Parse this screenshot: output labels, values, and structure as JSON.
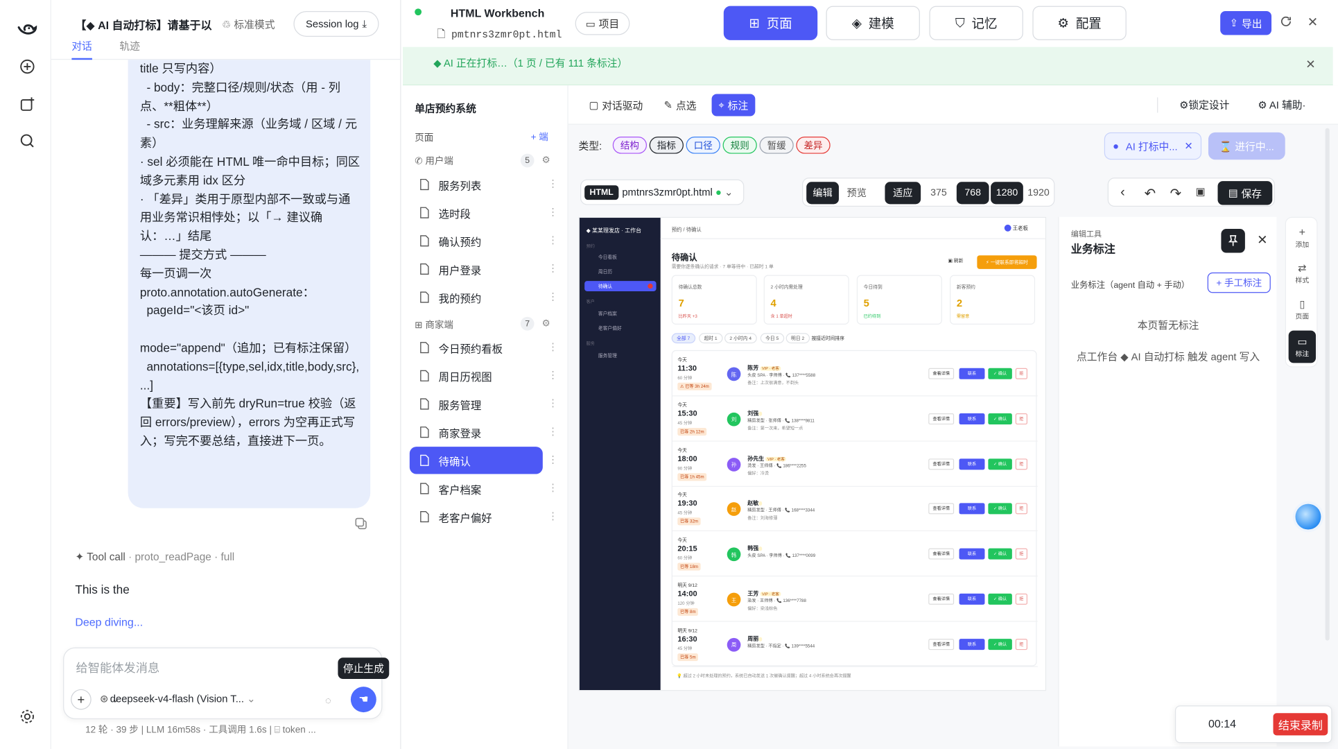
{
  "chat": {
    "title": "【◆ AI 自动打标】请基于以",
    "mode": "标准模式",
    "session_log": "Session log",
    "tabs": [
      "对话",
      "轨迹"
    ],
    "bubble_lines": [
      "title 只写内容）",
      "  - body：完整口径/规则/状态（用 - 列点、**粗体**）",
      "  - src：业务理解来源（业务域 / 区域 / 元素）",
      "· sel 必须能在 HTML 唯一命中目标；同区域多元素用 idx 区分",
      "· 「差异」类用于原型内部不一致或与通用业务常识相悖处；以「→ 建议确认：…」结尾",
      "",
      "——— 提交方式 ———",
      "每一页调一次 proto.annotation.autoGenerate：",
      "  pageId=\"<该页 id>\"",
      "  mode=\"append\"（追加；已有标注保留）",
      "  annotations=[{type,sel,idx,title,body,src}, ...]",
      "",
      "【重要】写入前先 dryRun=true 校验（返回 errors/preview），errors 为空再正式写入；写完不要总结，直接进下一页。"
    ],
    "tool_call": "Tool call",
    "tool_name": "proto_readPage · full",
    "reply_text": "This is the",
    "deep_diving": "Deep diving...",
    "input_placeholder": "给智能体发消息",
    "model": "deepseek-v4-flash (Vision T...",
    "tooltip": "停止生成",
    "stats": "12 轮 · 39 步  |  LLM 16m58s · 工具调用 1.6s  |  ⌸ token ..."
  },
  "header": {
    "title": "HTML Workbench",
    "file": "pmtnrs3zmr0pt.html",
    "project": "项目",
    "nav": [
      {
        "label": "页面",
        "icon": "grid-icon",
        "active": true
      },
      {
        "label": "建模",
        "icon": "layers-icon",
        "active": false
      },
      {
        "label": "记忆",
        "icon": "bookmark-icon",
        "active": false
      },
      {
        "label": "配置",
        "icon": "gear-icon",
        "active": false
      }
    ],
    "export": "导出"
  },
  "banner": {
    "text": "◆ AI 正在打标…（1 页 / 已有 111 条标注）"
  },
  "pages": {
    "system_name": "单店预约系统",
    "label": "页面",
    "add": "+ 端",
    "groups": [
      {
        "name": "用户端",
        "count": "5",
        "items": [
          "服务列表",
          "选时段",
          "确认预约",
          "用户登录",
          "我的预约"
        ]
      },
      {
        "name": "商家端",
        "count": "7",
        "items": [
          "今日预约看板",
          "周日历视图",
          "服务管理",
          "商家登录",
          "待确认",
          "客户档案",
          "老客户偏好"
        ]
      }
    ],
    "active": "待确认"
  },
  "toolbar": {
    "chat_driven": "对话驱动",
    "pick": "点选",
    "annotate": "标注",
    "lock_design": "锁定设计",
    "ai_assist": "AI 辅助·"
  },
  "types": {
    "label": "类型:",
    "chips": [
      {
        "label": "结构",
        "color": "#a855f7"
      },
      {
        "label": "指标",
        "color": "#1f2329"
      },
      {
        "label": "口径",
        "color": "#3b82f6"
      },
      {
        "label": "规则",
        "color": "#22c55e"
      },
      {
        "label": "暂缓",
        "color": "#9ca3af"
      },
      {
        "label": "差异",
        "color": "#e53935"
      }
    ],
    "ai_pill": "AI 打标中...",
    "progress": "⌛ 进行中..."
  },
  "canvas": {
    "html_tag": "HTML",
    "file": "pmtnrs3zmr0pt.html",
    "viewport": [
      "编辑",
      "预览",
      "适应",
      "375",
      "768",
      "1280",
      "1920"
    ],
    "save": "保存"
  },
  "preview": {
    "side_title": "◆ 某某理发店 · 工作台",
    "nav": [
      "今日看板",
      "周日历",
      "待确认",
      "客户档案",
      "老客户偏好",
      "服务管理"
    ],
    "nav_groups": [
      "预约",
      "客户",
      "服务"
    ],
    "breadcrumb": "预约 / 待确认",
    "user": "王老板",
    "title": "待确认",
    "subtitle": "需要你逐条确认的请求 · 7 单等待中 · 已超时 1 单",
    "btn_left": "▣ 刷新",
    "btn_right": "⚡ 一键联系即将超时",
    "cards": [
      {
        "label": "待确认总数",
        "value": "7",
        "sub": "比昨天 +3"
      },
      {
        "label": "2 小时内需处理",
        "value": "4",
        "sub": "含 1 单超时"
      },
      {
        "label": "今日待到",
        "value": "5",
        "sub": "已约待到"
      },
      {
        "label": "新客预约",
        "value": "2",
        "sub": "需留意"
      }
    ],
    "filters": [
      "全部 7",
      "超时 1",
      "2 小时内 4",
      "今日 5",
      "明日 2",
      "按接近时间排序"
    ],
    "rows": [
      {
        "day": "今天",
        "time": "11:30",
        "dur": "60 分钟",
        "tag": "⚠ 已等 3h 24m",
        "name": "陈芳",
        "badge": "VIP · 老客",
        "detail": "头皮 SPA · 李师傅 · 📞 137****5588",
        "note": "备注：上次很满意，不剃头",
        "color": "#6366f1"
      },
      {
        "day": "今天",
        "time": "15:30",
        "dur": "45 分钟",
        "tag": "已等 2h 12m",
        "name": "刘强",
        "badge": "",
        "detail": "精剪发型 · 张师傅 · 📞 138****9811",
        "note": "备注：第一次来，希望短一点",
        "color": "#22c55e"
      },
      {
        "day": "今天",
        "time": "18:00",
        "dur": "90 分钟",
        "tag": "已等 1h 45m",
        "name": "孙先生",
        "badge": "VIP · 老客",
        "detail": "烫发 · 王师傅 · 📞 186****2255",
        "note": "偏好：冷烫",
        "color": "#8b5cf6"
      },
      {
        "day": "今天",
        "time": "19:30",
        "dur": "45 分钟",
        "tag": "已等 32m",
        "name": "赵敏",
        "badge": "",
        "detail": "精剪发型 · 王师傅 · 📞 168****3344",
        "note": "备注：刘海修薄",
        "color": "#f59e0b"
      },
      {
        "day": "今天",
        "time": "20:15",
        "dur": "60 分钟",
        "tag": "已等 18m",
        "name": "韩强",
        "badge": "",
        "detail": "头皮 SPA · 李师傅 · 📞 137****0099",
        "note": "",
        "color": "#22c55e"
      },
      {
        "day": "明天 9/12",
        "time": "14:00",
        "dur": "120 分钟",
        "tag": "已等 8m",
        "name": "王芳",
        "badge": "VIP · 老客",
        "detail": "染发 · 王师傅 · 📞 136****7788",
        "note": "偏好：染浅棕色",
        "color": "#f59e0b"
      },
      {
        "day": "明天 9/12",
        "time": "16:30",
        "dur": "45 分钟",
        "tag": "已等 5m",
        "name": "周丽",
        "badge": "",
        "detail": "精剪发型 · 不指定 · 📞 139****5544",
        "note": "",
        "color": "#8b5cf6"
      }
    ],
    "row_buttons": [
      "查看详情",
      "联系",
      "✓ 确认",
      "拒"
    ],
    "footer": "💡 超过 2 小时未处理的预约，系统已自动发送 1 次催确认提醒；超过 4 小时系统会再次提醒"
  },
  "annotation_panel": {
    "sub": "编辑工具",
    "title": "业务标注",
    "biz_label": "业务标注（agent 自动 + 手动）",
    "manual": "+ 手工标注",
    "empty": "本页暂无标注",
    "hint": "点工作台 ◆ AI 自动打标 触发 agent 写入"
  },
  "tools": [
    {
      "label": "添加",
      "icon": "plus-icon"
    },
    {
      "label": "样式",
      "icon": "sliders-icon"
    },
    {
      "label": "页面",
      "icon": "page-icon"
    },
    {
      "label": "标注",
      "icon": "comment-icon"
    }
  ],
  "recorder": {
    "time": "00:14",
    "stop": "结束录制"
  }
}
